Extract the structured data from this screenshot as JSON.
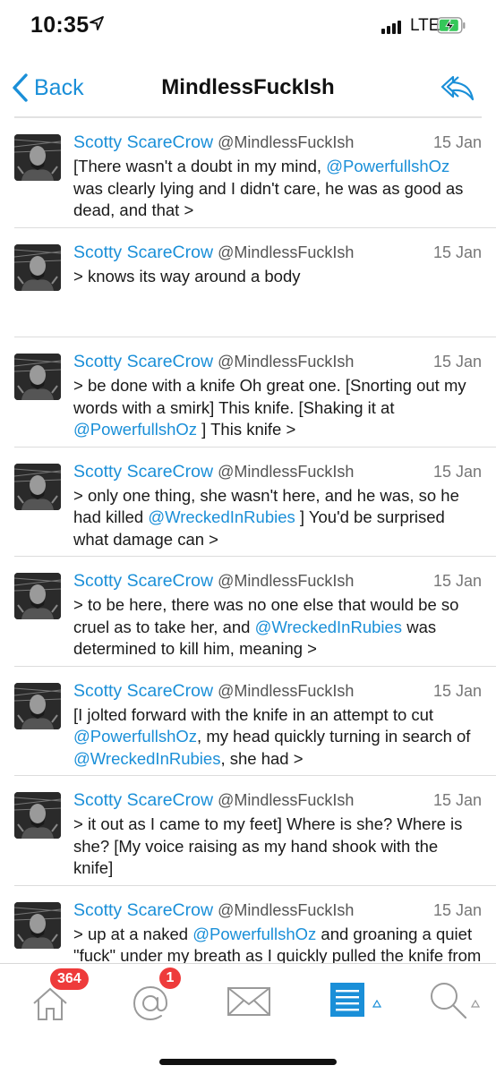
{
  "status_bar": {
    "time": "10:35",
    "network": "LTE"
  },
  "nav": {
    "back_label": "Back",
    "title": "MindlessFuckIsh"
  },
  "tweets": [
    {
      "name": "Scotty ScareCrow",
      "handle": "@MindlessFuckIsh",
      "date": "15 Jan",
      "segments": [
        {
          "text": "[There wasn't a doubt in my mind, "
        },
        {
          "text": "@PowerfullshOz",
          "mention": true
        },
        {
          "text": " was clearly lying and I didn't care, he was as good as dead, and that >"
        }
      ]
    },
    {
      "name": "Scotty ScareCrow",
      "handle": "@MindlessFuckIsh",
      "date": "15 Jan",
      "segments": [
        {
          "text": "> knows its way around a body"
        }
      ]
    },
    {
      "name": "Scotty ScareCrow",
      "handle": "@MindlessFuckIsh",
      "date": "15 Jan",
      "segments": [
        {
          "text": "> be done with a knife Oh great one. [Snorting out my words with a smirk] This knife. [Shaking it at "
        },
        {
          "text": "@PowerfullshOz",
          "mention": true
        },
        {
          "text": " ] This knife >"
        }
      ]
    },
    {
      "name": "Scotty ScareCrow",
      "handle": "@MindlessFuckIsh",
      "date": "15 Jan",
      "segments": [
        {
          "text": "> only one thing, she wasn't here, and he was, so he had killed "
        },
        {
          "text": "@WreckedInRubies",
          "mention": true
        },
        {
          "text": " ] You'd be surprised what damage can >"
        }
      ]
    },
    {
      "name": "Scotty ScareCrow",
      "handle": "@MindlessFuckIsh",
      "date": "15 Jan",
      "segments": [
        {
          "text": "> to be here, there was no one else that would be so cruel as to take her, and "
        },
        {
          "text": "@WreckedInRubies",
          "mention": true
        },
        {
          "text": " was determined to kill him, meaning >"
        }
      ]
    },
    {
      "name": "Scotty ScareCrow",
      "handle": "@MindlessFuckIsh",
      "date": "15 Jan",
      "segments": [
        {
          "text": "[I jolted forward with the knife in an attempt to cut "
        },
        {
          "text": "@PowerfullshOz",
          "mention": true
        },
        {
          "text": ", my head quickly turning in search of "
        },
        {
          "text": "@WreckedInRubies",
          "mention": true
        },
        {
          "text": ", she had >"
        }
      ]
    },
    {
      "name": "Scotty ScareCrow",
      "handle": "@MindlessFuckIsh",
      "date": "15 Jan",
      "segments": [
        {
          "text": "> it out as I came to my feet] Where is she? Where is she? [My voice raising as my hand shook with the knife]"
        }
      ]
    },
    {
      "name": "Scotty ScareCrow",
      "handle": "@MindlessFuckIsh",
      "date": "15 Jan",
      "segments": [
        {
          "text": "> up at a naked "
        },
        {
          "text": "@PowerfullshOz",
          "mention": true
        },
        {
          "text": " and groaning a quiet \"fuck\" under my breath as I quickly pulled the knife from my back pocket, holding >"
        }
      ]
    }
  ],
  "tab_bar": {
    "home_badge": "364",
    "mentions_badge": "1",
    "tabs": [
      "home-icon",
      "mention-icon",
      "envelope-icon",
      "list-icon",
      "search-icon"
    ]
  },
  "colors": {
    "accent": "#1a8fd8",
    "badge": "#ee3b3b"
  }
}
